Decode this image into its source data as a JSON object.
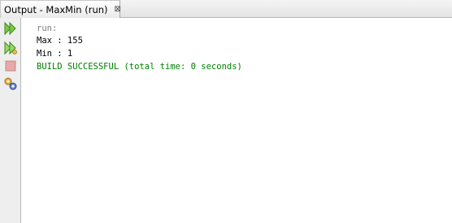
{
  "tab": {
    "title": "Output - MaxMin (run)",
    "close_glyph": "⊠"
  },
  "toolbar": {
    "buttons": [
      {
        "name": "rerun-icon"
      },
      {
        "name": "rerun-with-options-icon"
      },
      {
        "name": "stop-icon"
      },
      {
        "name": "settings-icon"
      }
    ]
  },
  "output": {
    "lines": [
      {
        "text": "run:",
        "color": "#808080"
      },
      {
        "text": "Max : 155",
        "color": "#000000"
      },
      {
        "text": "Min : 1",
        "color": "#000000"
      },
      {
        "text": "BUILD SUCCESSFUL (total time: 0 seconds)",
        "color": "#008000"
      }
    ]
  }
}
